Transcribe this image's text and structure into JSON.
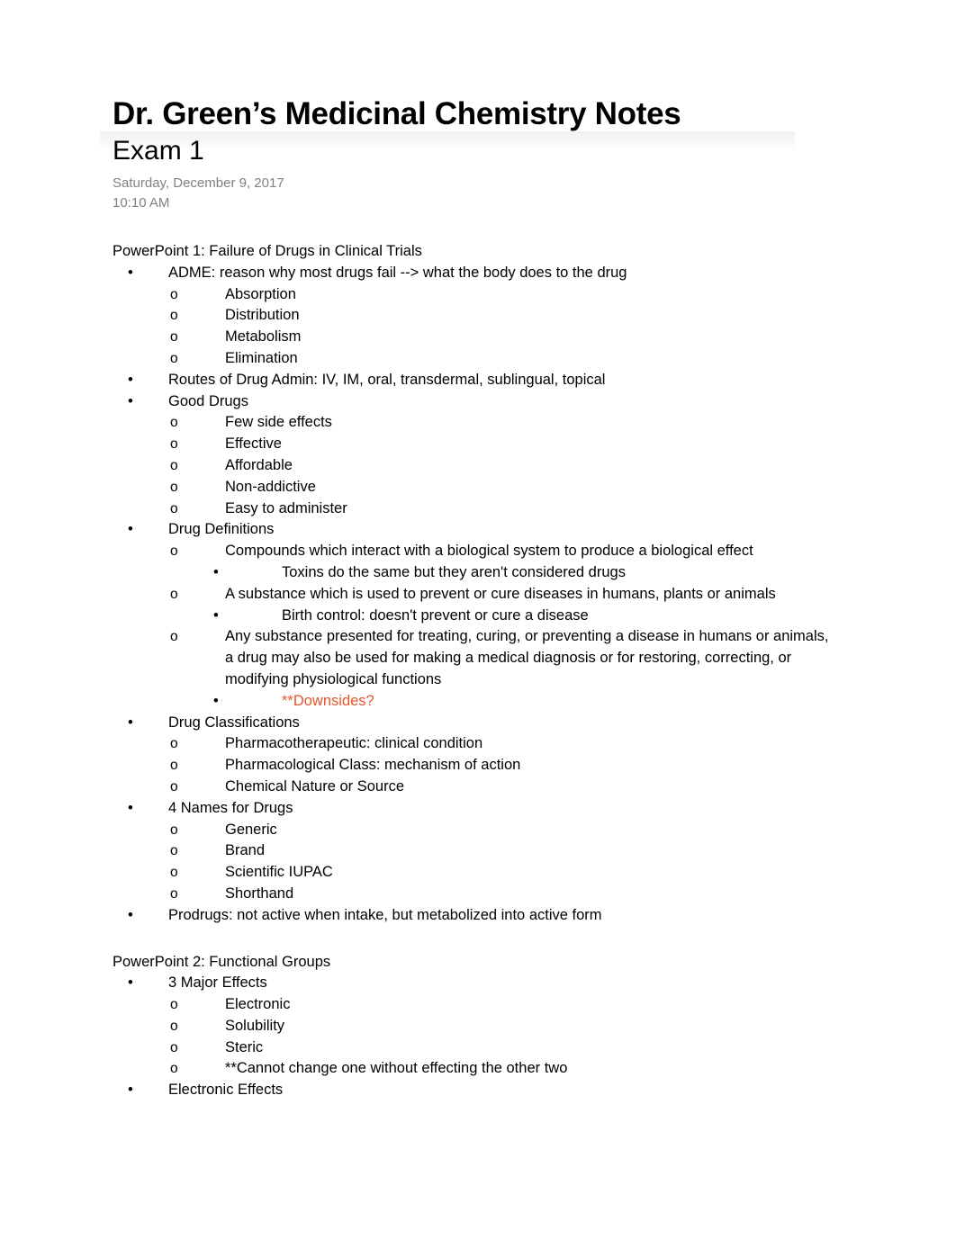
{
  "header": {
    "title": "Dr. Green’s Medicinal Chemistry Notes",
    "subtitle": "Exam 1",
    "date": "Saturday, December 9, 2017",
    "time": "10:10 AM"
  },
  "markers": {
    "bullet": "•",
    "circle": "o"
  },
  "colors": {
    "text": "#000000",
    "muted": "#808080",
    "accent_red": "#E8532C"
  },
  "sections": [
    {
      "heading": "PowerPoint 1: Failure of Drugs in Clinical Trials",
      "items": [
        {
          "level": 1,
          "text": "ADME: reason why most drugs fail --> what the body does to the drug"
        },
        {
          "level": 2,
          "text": "Absorption"
        },
        {
          "level": 2,
          "text": "Distribution"
        },
        {
          "level": 2,
          "text": "Metabolism"
        },
        {
          "level": 2,
          "text": "Elimination"
        },
        {
          "level": 1,
          "text": "Routes of Drug Admin: IV, IM, oral, transdermal, sublingual, topical"
        },
        {
          "level": 1,
          "text": "Good Drugs"
        },
        {
          "level": 2,
          "text": "Few side effects"
        },
        {
          "level": 2,
          "text": "Effective"
        },
        {
          "level": 2,
          "text": "Affordable"
        },
        {
          "level": 2,
          "text": "Non-addictive"
        },
        {
          "level": 2,
          "text": "Easy to administer"
        },
        {
          "level": 1,
          "text": "Drug Definitions"
        },
        {
          "level": 2,
          "text": "Compounds which interact with a biological system to produce a biological effect"
        },
        {
          "level": 3,
          "text": "Toxins do the same but they aren't considered drugs"
        },
        {
          "level": 2,
          "text": "A substance which is used to prevent or cure diseases in humans, plants or animals"
        },
        {
          "level": 3,
          "text": "Birth control: doesn't prevent or cure a disease"
        },
        {
          "level": 2,
          "wrap": true,
          "text": "Any substance presented for treating, curing, or preventing a disease in humans or animals, a drug may also be used for making a medical diagnosis or for restoring, correcting, or modifying physiological functions"
        },
        {
          "level": 3,
          "accent": "red",
          "text": "**Downsides?"
        },
        {
          "level": 1,
          "text": "Drug Classifications"
        },
        {
          "level": 2,
          "text": "Pharmacotherapeutic: clinical condition"
        },
        {
          "level": 2,
          "text": "Pharmacological Class: mechanism of action"
        },
        {
          "level": 2,
          "text": "Chemical Nature or Source"
        },
        {
          "level": 1,
          "text": "4 Names for Drugs"
        },
        {
          "level": 2,
          "text": "Generic"
        },
        {
          "level": 2,
          "text": "Brand"
        },
        {
          "level": 2,
          "text": "Scientific IUPAC"
        },
        {
          "level": 2,
          "text": "Shorthand"
        },
        {
          "level": 1,
          "text": "Prodrugs: not active when intake, but metabolized into active form"
        }
      ]
    },
    {
      "heading": "PowerPoint 2: Functional Groups",
      "items": [
        {
          "level": 1,
          "text": "3 Major Effects"
        },
        {
          "level": 2,
          "text": "Electronic"
        },
        {
          "level": 2,
          "text": "Solubility"
        },
        {
          "level": 2,
          "text": "Steric"
        },
        {
          "level": 2,
          "text": "**Cannot change one without effecting the other two"
        },
        {
          "level": 1,
          "text": "Electronic Effects"
        }
      ]
    }
  ]
}
